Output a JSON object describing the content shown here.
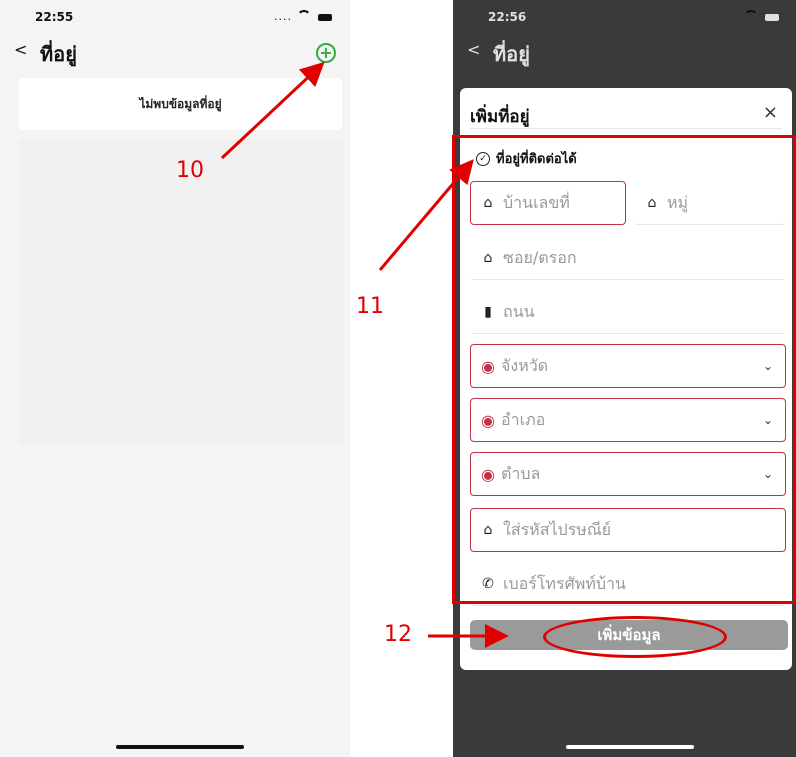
{
  "left_screen": {
    "status_time": "22:55",
    "back_glyph": "<",
    "title": "ที่อยู่",
    "add_icon": "plus-circle-icon",
    "add_glyph": "+",
    "empty_message": "ไม่พบข้อมูลที่อยู่"
  },
  "right_screen": {
    "status_time": "22:56",
    "back_glyph": "<",
    "title": "ที่อยู่",
    "modal": {
      "title": "เพิ่มที่อยู่",
      "close_glyph": "×",
      "contact_label": "ที่อยู่ที่ติดต่อได้",
      "fields": {
        "house_no_placeholder": "บ้านเลขที่",
        "moo_placeholder": "หมู่",
        "soi_placeholder": "ซอย/ตรอก",
        "road_placeholder": "ถนน",
        "province_placeholder": "จังหวัด",
        "district_placeholder": "อำเภอ",
        "subdistrict_placeholder": "ตำบล",
        "postcode_placeholder": "ใส่รหัสไปรษณีย์",
        "phone_placeholder": "เบอร์โทรศัพท์บ้าน"
      },
      "submit_label": "เพิ่มข้อมูล"
    }
  },
  "annotations": {
    "step_10": "10",
    "step_11": "11",
    "step_12": "12",
    "color": "#e10000"
  }
}
